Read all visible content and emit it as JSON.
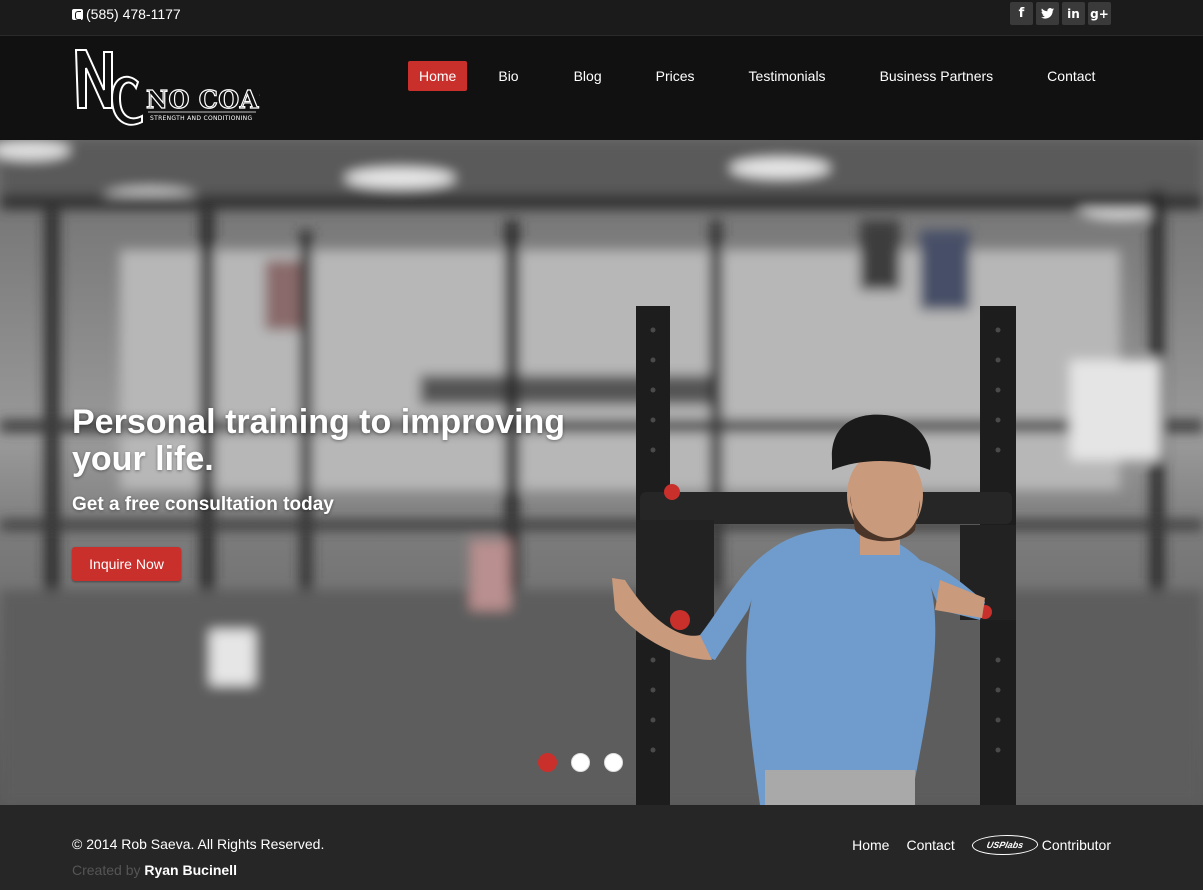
{
  "topbar": {
    "phone": "(585) 478-1177",
    "social": [
      {
        "icon": "facebook-icon",
        "glyph": "f"
      },
      {
        "icon": "twitter-icon",
        "glyph": "t"
      },
      {
        "icon": "linkedin-icon",
        "glyph": "in"
      },
      {
        "icon": "google-plus-icon",
        "glyph": "g+"
      }
    ]
  },
  "header": {
    "logo_text": "NO COAST",
    "logo_tagline": "STRENGTH AND CONDITIONING",
    "logo_monogram": "NC",
    "nav": [
      {
        "label": "Home",
        "active": true
      },
      {
        "label": "Bio",
        "active": false
      },
      {
        "label": "Blog",
        "active": false
      },
      {
        "label": "Prices",
        "active": false
      },
      {
        "label": "Testimonials",
        "active": false
      },
      {
        "label": "Business Partners",
        "active": false
      },
      {
        "label": "Contact",
        "active": false
      }
    ]
  },
  "hero": {
    "title": "Personal training to improving your life.",
    "subtitle": "Get a free consultation today",
    "button": "Inquire Now",
    "slides_total": 3,
    "active_slide": 1
  },
  "footer": {
    "copyright": "© 2014 Rob Saeva. All Rights Reserved.",
    "created_by_prefix": "Created by",
    "created_by_name": "Ryan Bucinell",
    "links": [
      "Home",
      "Contact"
    ],
    "usp_logo_text": "USPlabs",
    "contributor": "Contributor"
  },
  "colors": {
    "accent": "#c9302c",
    "topbar": "#1b1b1b",
    "header": "#111111",
    "footer": "#262626"
  }
}
